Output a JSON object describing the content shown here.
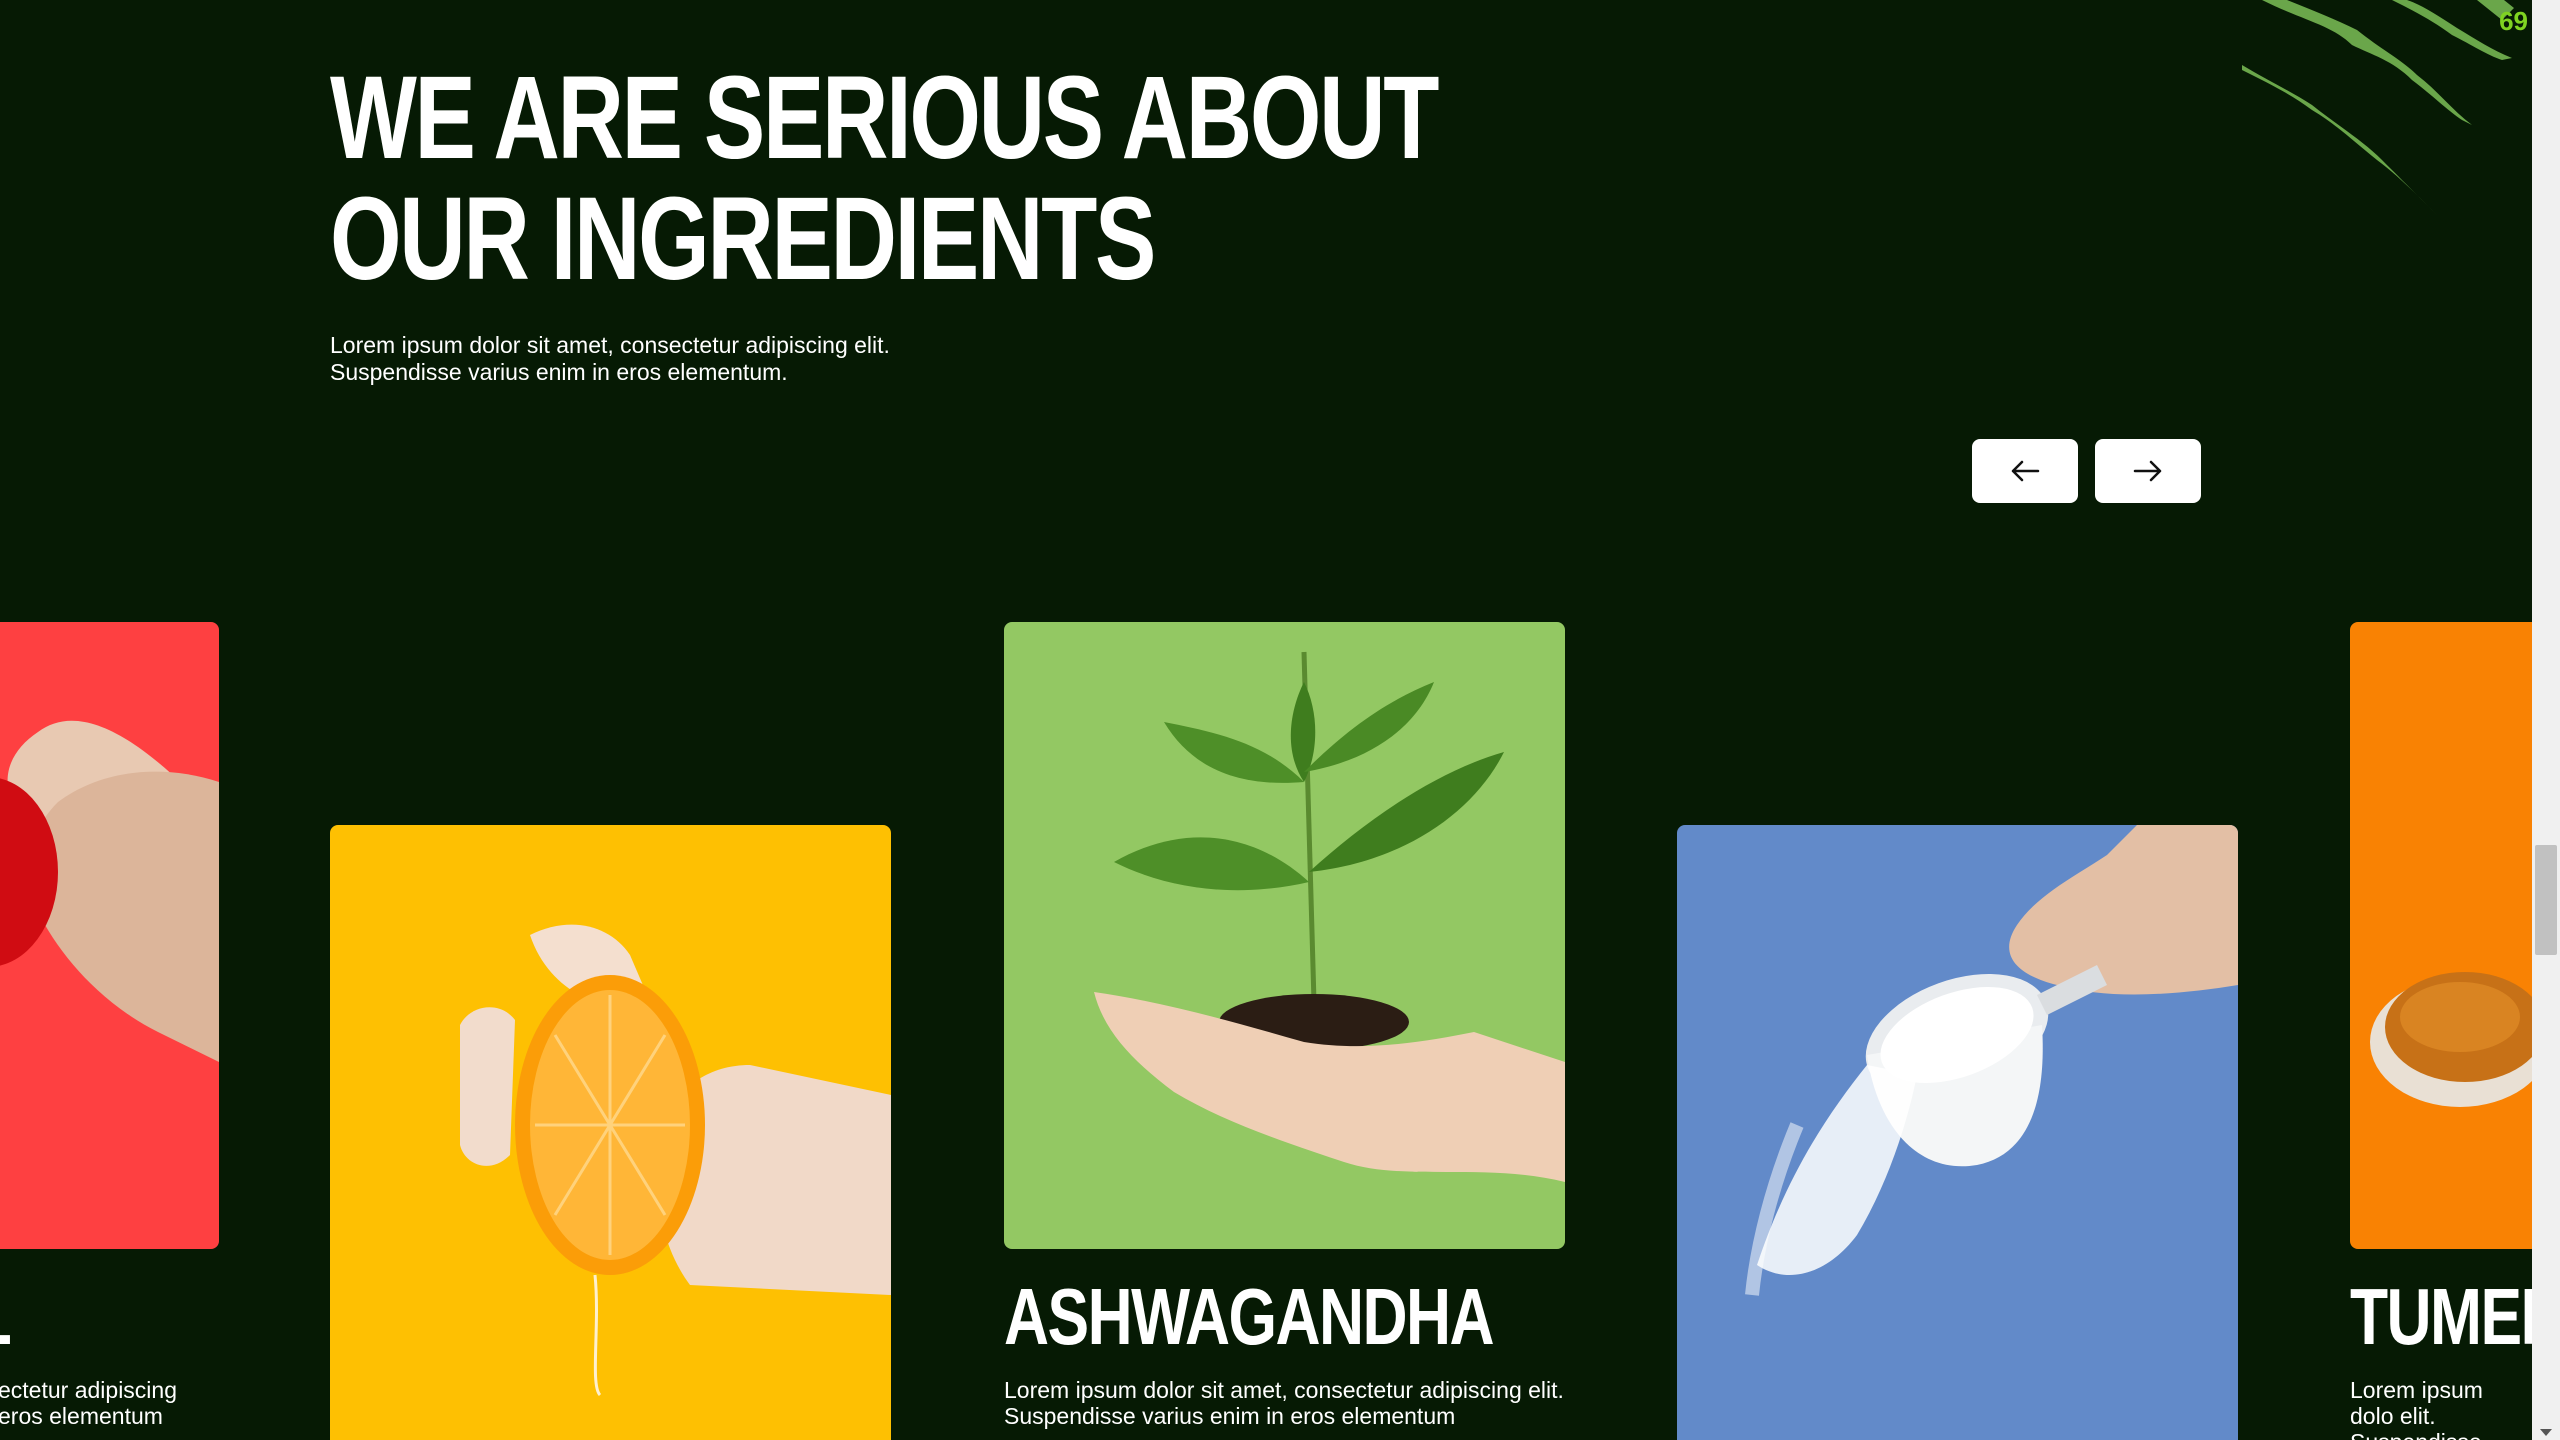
{
  "section": {
    "heading_line1": "WE ARE SERIOUS ABOUT",
    "heading_line2": "OUR INGREDIENTS",
    "subtext_line1": "Lorem ipsum dolor sit amet, consectetur adipiscing elit.",
    "subtext_line2": "Suspendisse varius enim in eros elementum."
  },
  "nav": {
    "prev_icon": "arrow-left-icon",
    "next_icon": "arrow-right-icon"
  },
  "cards": [
    {
      "title": "IL",
      "desc": "ectetur adipiscing eros elementum",
      "color": "#fe4041",
      "image": "hand-holding-tomato"
    },
    {
      "title": "",
      "desc": "",
      "color": "#fec002",
      "image": "hand-squeezing-orange"
    },
    {
      "title": "ASHWAGANDHA",
      "desc": "Lorem ipsum dolor sit amet, consectetur adipiscing elit. Suspendisse varius enim in eros elementum",
      "color": "#93c863",
      "image": "hand-holding-seedling"
    },
    {
      "title": "",
      "desc": "",
      "color": "#628ac9",
      "image": "hand-pouring-salt-cup"
    },
    {
      "title": "TUMER",
      "desc": "Lorem ipsum dolo elit. Suspendisse",
      "color": "#f98203",
      "image": "spoon-of-turmeric"
    }
  ],
  "badge": "69"
}
